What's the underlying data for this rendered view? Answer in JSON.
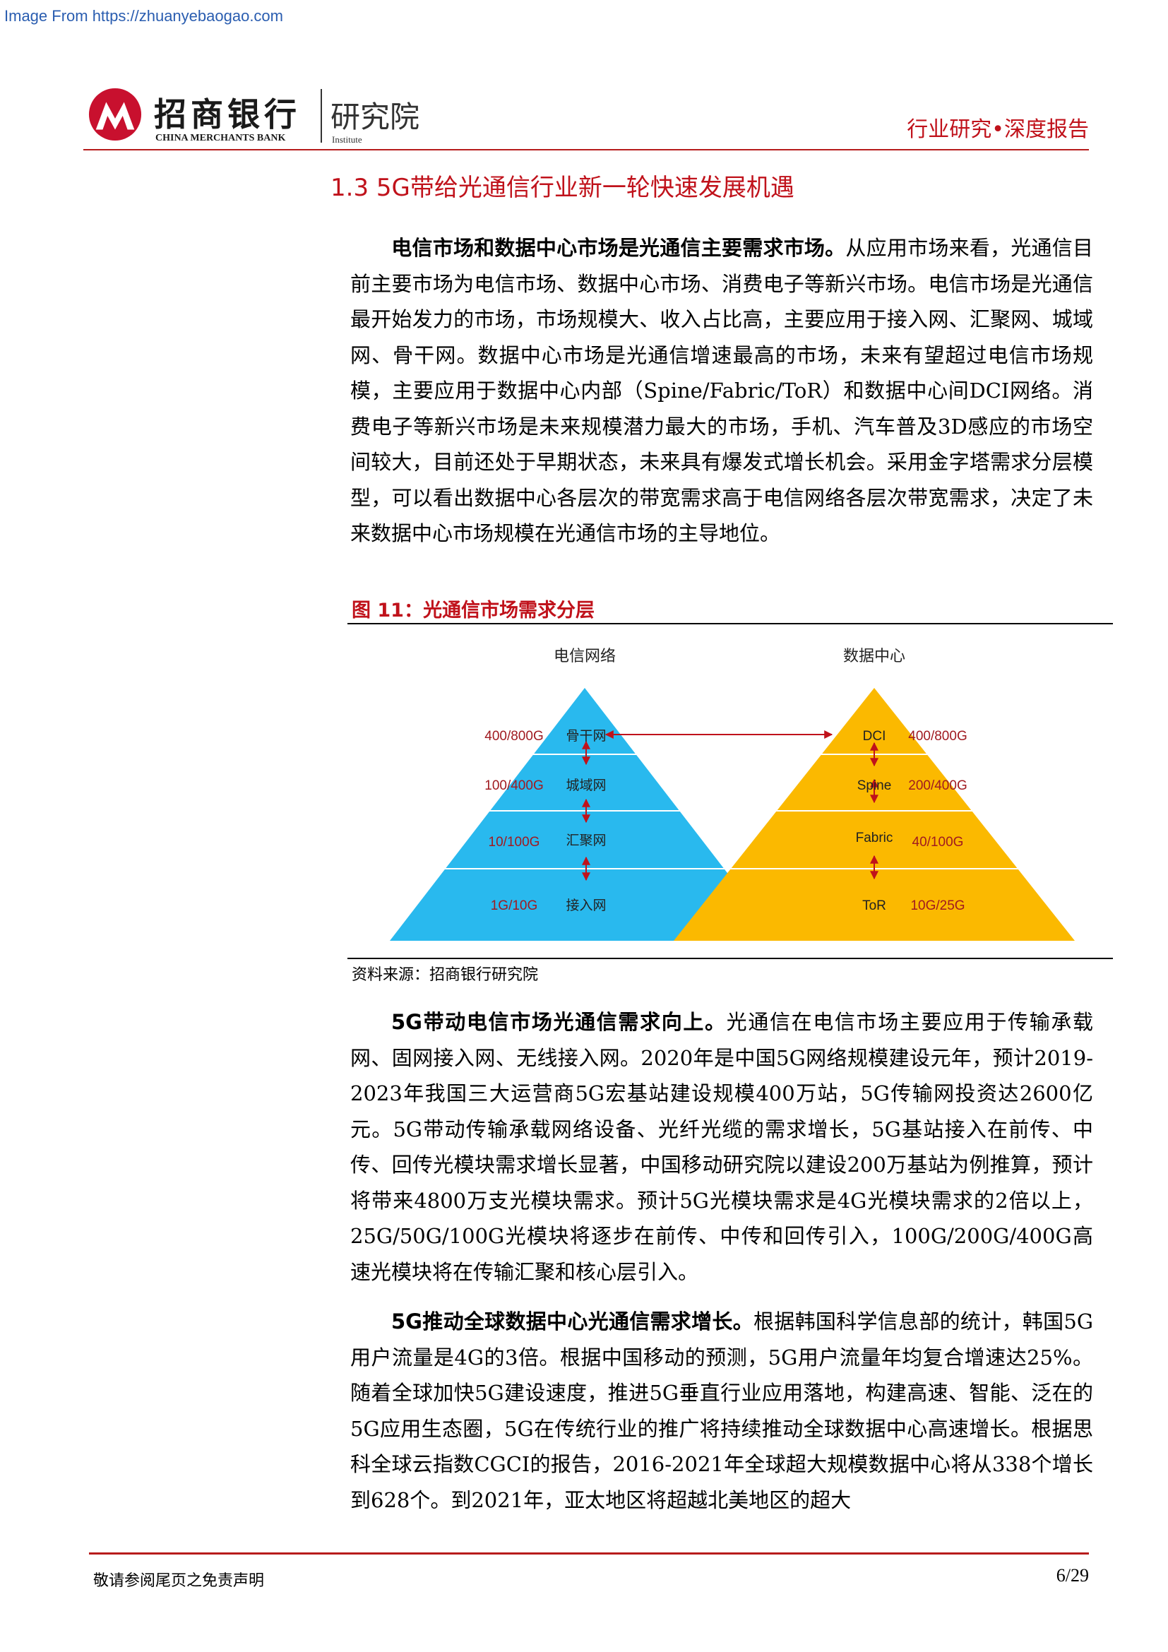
{
  "watermark": "Image From https://zhuanyebaogao.com",
  "header": {
    "bank_cn": "招商银行",
    "bank_en": "CHINA MERCHANTS BANK",
    "institute_cn": "研究院",
    "institute_en": "Institute",
    "report_type": "行业研究•深度报告",
    "brand_color": "#c0121b"
  },
  "section_title": "1.3 5G带给光通信行业新一轮快速发展机遇",
  "paragraphs": [
    {
      "lead": "电信市场和数据中心市场是光通信主要需求市场。",
      "text": "从应用市场来看，光通信目前主要市场为电信市场、数据中心市场、消费电子等新兴市场。电信市场是光通信最开始发力的市场，市场规模大、收入占比高，主要应用于接入网、汇聚网、城域网、骨干网。数据中心市场是光通信增速最高的市场，未来有望超过电信市场规模，主要应用于数据中心内部（Spine/Fabric/ToR）和数据中心间DCI网络。消费电子等新兴市场是未来规模潜力最大的市场，手机、汽车普及3D感应的市场空间较大，目前还处于早期状态，未来具有爆发式增长机会。采用金字塔需求分层模型，可以看出数据中心各层次的带宽需求高于电信网络各层次带宽需求，决定了未来数据中心市场规模在光通信市场的主导地位。"
    },
    {
      "lead": "5G带动电信市场光通信需求向上。",
      "text": "光通信在电信市场主要应用于传输承载网、固网接入网、无线接入网。2020年是中国5G网络规模建设元年，预计2019-2023年我国三大运营商5G宏基站建设规模400万站，5G传输网投资达2600亿元。5G带动传输承载网络设备、光纤光缆的需求增长，5G基站接入在前传、中传、回传光模块需求增长显著，中国移动研究院以建设200万基站为例推算，预计将带来4800万支光模块需求。预计5G光模块需求是4G光模块需求的2倍以上，25G/50G/100G光模块将逐步在前传、中传和回传引入，100G/200G/400G高速光模块将在传输汇聚和核心层引入。"
    },
    {
      "lead": "5G推动全球数据中心光通信需求增长。",
      "text": "根据韩国科学信息部的统计，韩国5G用户流量是4G的3倍。根据中国移动的预测，5G用户流量年均复合增速达25%。随着全球加快5G建设速度，推进5G垂直行业应用落地，构建高速、智能、泛在的5G应用生态圈，5G在传统行业的推广将持续推动全球数据中心高速增长。根据思科全球云指数CGCI的报告，2016-2021年全球超大规模数据中心将从338个增长到628个。到2021年，亚太地区将超越北美地区的超大"
    }
  ],
  "figure": {
    "title": "图 11：光通信市场需求分层",
    "source": "资料来源：招商银行研究院",
    "telecom": {
      "title": "电信网络",
      "color": "#29b9ee",
      "layers": [
        {
          "name": "骨干网",
          "bandwidth": "400/800G"
        },
        {
          "name": "城域网",
          "bandwidth": "100/400G"
        },
        {
          "name": "汇聚网",
          "bandwidth": "10/100G"
        },
        {
          "name": "接入网",
          "bandwidth": "1G/10G"
        }
      ]
    },
    "datacenter": {
      "title": "数据中心",
      "color": "#fbb900",
      "layers": [
        {
          "name": "DCI",
          "bandwidth": "400/800G"
        },
        {
          "name": "Spine",
          "bandwidth": "200/400G"
        },
        {
          "name": "Fabric",
          "bandwidth": "40/100G"
        },
        {
          "name": "ToR",
          "bandwidth": "10G/25G"
        }
      ]
    },
    "arrow_color": "#c0121b"
  },
  "footer": {
    "disclaimer": "敬请参阅尾页之免责声明",
    "page": "6/29"
  }
}
